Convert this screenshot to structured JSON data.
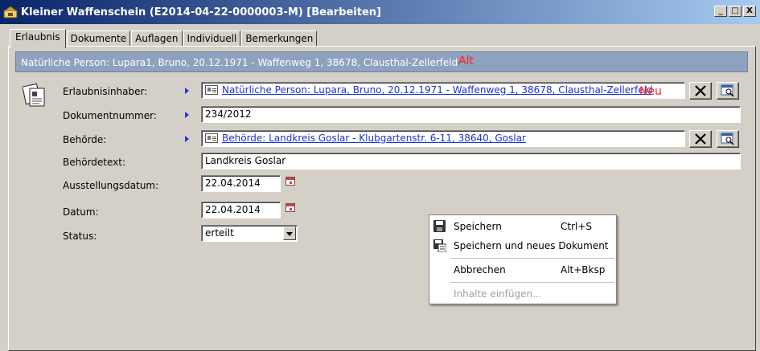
{
  "window": {
    "title": "Kleiner Waffenschein (E2014-04-22-0000003-M) [Bearbeiten]",
    "controls": [
      "_",
      "□",
      "X"
    ]
  },
  "tabs": [
    {
      "label": "Erlaubnis",
      "active": true
    },
    {
      "label": "Dokumente",
      "active": false
    },
    {
      "label": "Auflagen",
      "active": false
    },
    {
      "label": "Individuell",
      "active": false
    },
    {
      "label": "Bemerkungen",
      "active": false
    }
  ],
  "band": {
    "text": "Natürliche Person: Lupara1, Bruno, 20.12.1971 - Waffenweg 1, 38678, Clausthal-Zellerfeld",
    "alt_label": "Alt"
  },
  "form": {
    "inhaber_label": "Erlaubnisinhaber:",
    "inhaber_value": "Natürliche Person: Lupara, Bruno, 20.12.1971 - Waffenweg 1, 38678, Clausthal-Zellerfeld",
    "neu_label": "Neu",
    "dokumentnummer_label": "Dokumentnummer:",
    "dokumentnummer_value": "234/2012",
    "behoerde_label": "Behörde:",
    "behoerde_value": "Behörde: Landkreis Goslar - Klubgartenstr. 6-11, 38640, Goslar",
    "behoerdetext_label": "Behördetext:",
    "behoerdetext_value": "Landkreis Goslar",
    "ausstellungsdatum_label": "Ausstellungsdatum:",
    "ausstellungsdatum_value": "22.04.2014",
    "datum_label": "Datum:",
    "datum_value": "22.04.2014",
    "status_label": "Status:",
    "status_value": "erteilt"
  },
  "context_menu": {
    "items": [
      {
        "label": "Speichern",
        "shortcut": "Ctrl+S",
        "icon": "save-icon",
        "enabled": true
      },
      {
        "label": "Speichern und neues Dokument",
        "shortcut": "",
        "icon": "save-new-icon",
        "enabled": true
      },
      {
        "label": "Abbrechen",
        "shortcut": "Alt+Bksp",
        "icon": "",
        "enabled": true
      },
      {
        "label": "Inhalte einfügen...",
        "shortcut": "",
        "icon": "",
        "enabled": false
      }
    ]
  },
  "colors": {
    "title_gradient_start": "#0a246a",
    "band_bg": "#8ea1be",
    "annotation_red": "#ff2020",
    "link_blue": "#1a33cc"
  }
}
